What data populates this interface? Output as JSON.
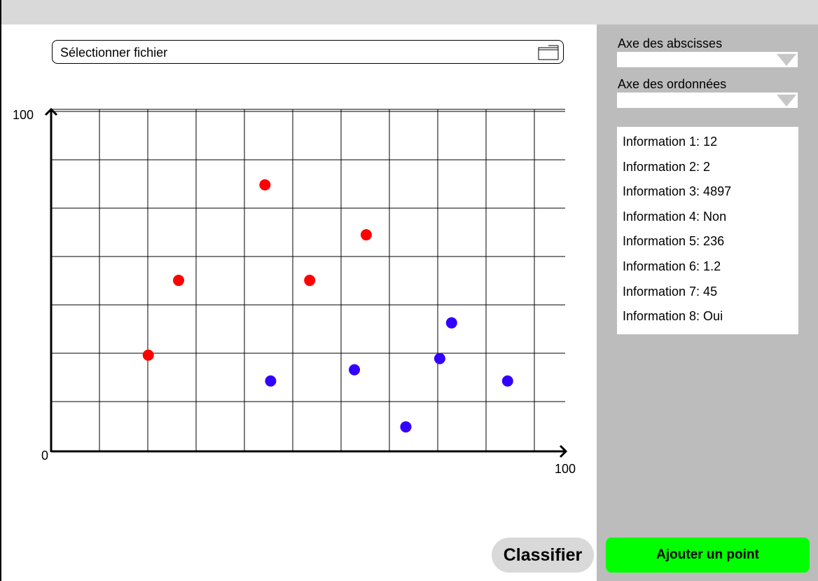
{
  "file_selector": {
    "label": "Sélectionner fichier",
    "icon": "folder-icon"
  },
  "sidebar": {
    "x_axis_label": "Axe des abscisses",
    "y_axis_label": "Axe des ordonnées",
    "x_axis_value": "",
    "y_axis_value": "",
    "info": [
      "Information 1: 12",
      "Information 2: 2",
      "Information 3: 4897",
      "Information 4: Non",
      "Information 5: 236",
      "Information 6: 1.2",
      "Information 7: 45",
      "Information 8: Oui"
    ]
  },
  "buttons": {
    "classify": "Classifier",
    "add_point": "Ajouter un point"
  },
  "colors": {
    "add_point_bg": "#00ff00",
    "classify_bg": "#d9d9d9",
    "sidebar_bg": "#bcbcbc",
    "class_red": "#ff0000",
    "class_blue": "#3300ff"
  },
  "chart_data": {
    "type": "scatter",
    "xlim": [
      0,
      100
    ],
    "ylim": [
      0,
      100
    ],
    "x_tick_label": "100",
    "y_tick_labels": [
      "0",
      "100"
    ],
    "grid": true,
    "series": [
      {
        "color": "#ff0000",
        "points": [
          {
            "x": 18.9,
            "y": 28.3
          },
          {
            "x": 24.8,
            "y": 50.3
          },
          {
            "x": 41.6,
            "y": 78.4
          },
          {
            "x": 50.3,
            "y": 50.3
          },
          {
            "x": 61.3,
            "y": 63.7
          }
        ]
      },
      {
        "color": "#3300ff",
        "points": [
          {
            "x": 42.7,
            "y": 20.7
          },
          {
            "x": 59.0,
            "y": 24.0
          },
          {
            "x": 69.0,
            "y": 7.2
          },
          {
            "x": 75.6,
            "y": 27.3
          },
          {
            "x": 77.9,
            "y": 37.8
          },
          {
            "x": 88.8,
            "y": 20.7
          }
        ]
      }
    ]
  }
}
